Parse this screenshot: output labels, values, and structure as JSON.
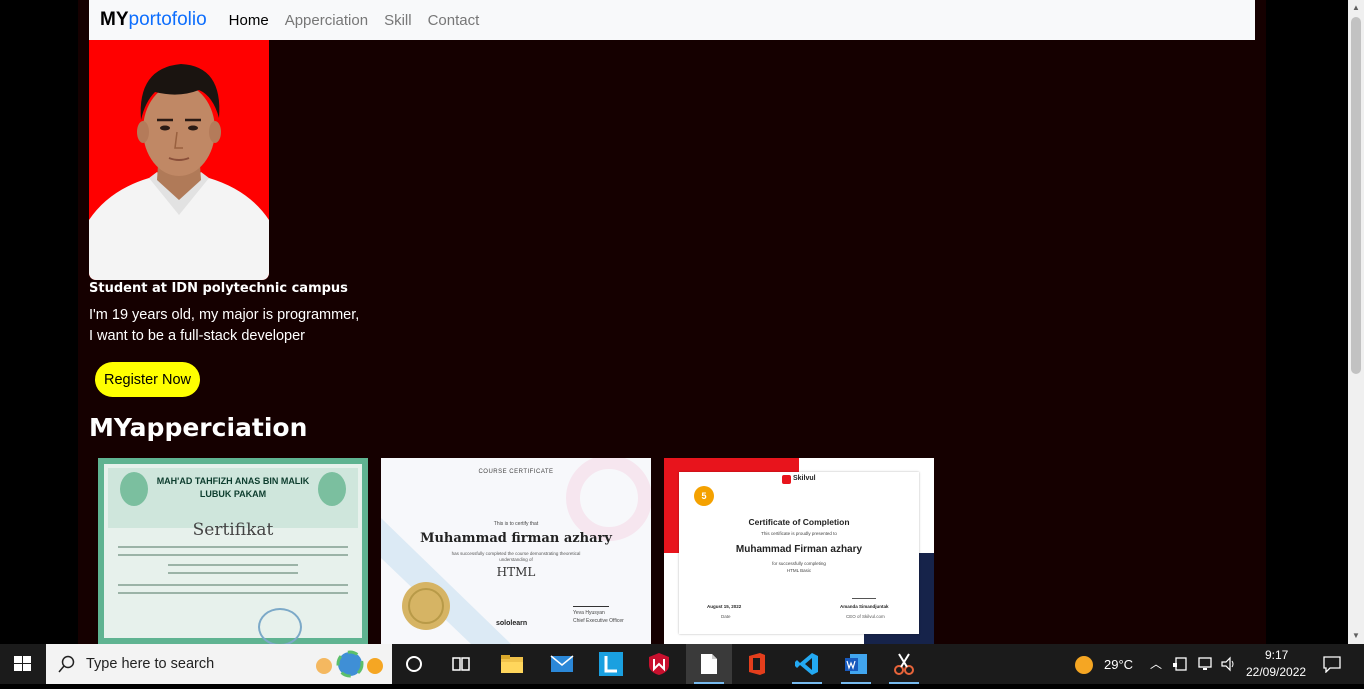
{
  "navbar": {
    "brand_bold": "MY",
    "brand_rest": "portofolio",
    "links": [
      "Home",
      "Apperciation",
      "Skill",
      "Contact"
    ]
  },
  "hero": {
    "title": "Student at IDN polytechnic campus",
    "line1": "I'm 19 years old, my major is programmer,",
    "line2": "I want to be a full-stack developer",
    "button": "Register Now"
  },
  "section": {
    "title": "MYapperciation"
  },
  "certificates": [
    {
      "header1": "MAH'AD TAHFIZH ANAS BIN MALIK",
      "header2": "LUBUK PAKAM",
      "title": "Sertifikat"
    },
    {
      "label": "COURSE CERTIFICATE",
      "cert_of": "This is to certify that",
      "name": "Muhammad firman azhary",
      "desc": "has successfully completed the course demonstrating theoretical understanding of",
      "course": "HTML",
      "brand": "sololearn",
      "signer": "Yeva Hyusyan",
      "signer_role": "Chief Executive Officer"
    },
    {
      "brand": "Skilvul",
      "badge": "5",
      "title": "Certificate of Completion",
      "presented": "This certificate is proudly presented to",
      "name": "Muhammad Firman azhary",
      "for_text": "for successfully completing",
      "course": "HTML Basic",
      "date": "August 15, 2022",
      "date_label": "Date",
      "signer": "Amanda Simandjuntak",
      "signer_role": "CEO of Skilvul.com"
    }
  ],
  "taskbar": {
    "search_placeholder": "Type here to search",
    "weather": "29°C",
    "time": "9:17",
    "date": "22/09/2022"
  },
  "colors": {
    "page_bg": "#150000",
    "nav_bg": "#f8f9fa",
    "brand_accent": "#0d6efd",
    "button_bg": "#ffff00",
    "photo_bg": "#ff0000",
    "taskbar_bg": "#1b1b1b"
  }
}
